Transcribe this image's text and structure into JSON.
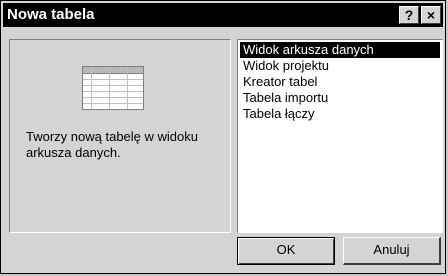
{
  "window": {
    "title": "Nowa tabela",
    "help_label": "?",
    "close_label": "×"
  },
  "preview": {
    "icon": "table-grid-icon",
    "description": "Tworzy nową tabelę w widoku arkusza danych."
  },
  "list": {
    "items": [
      {
        "label": "Widok arkusza danych",
        "selected": true
      },
      {
        "label": "Widok projektu",
        "selected": false
      },
      {
        "label": "Kreator tabel",
        "selected": false
      },
      {
        "label": "Tabela importu",
        "selected": false
      },
      {
        "label": "Tabela łączy",
        "selected": false
      }
    ]
  },
  "buttons": {
    "ok_label": "OK",
    "cancel_label": "Anuluj"
  }
}
